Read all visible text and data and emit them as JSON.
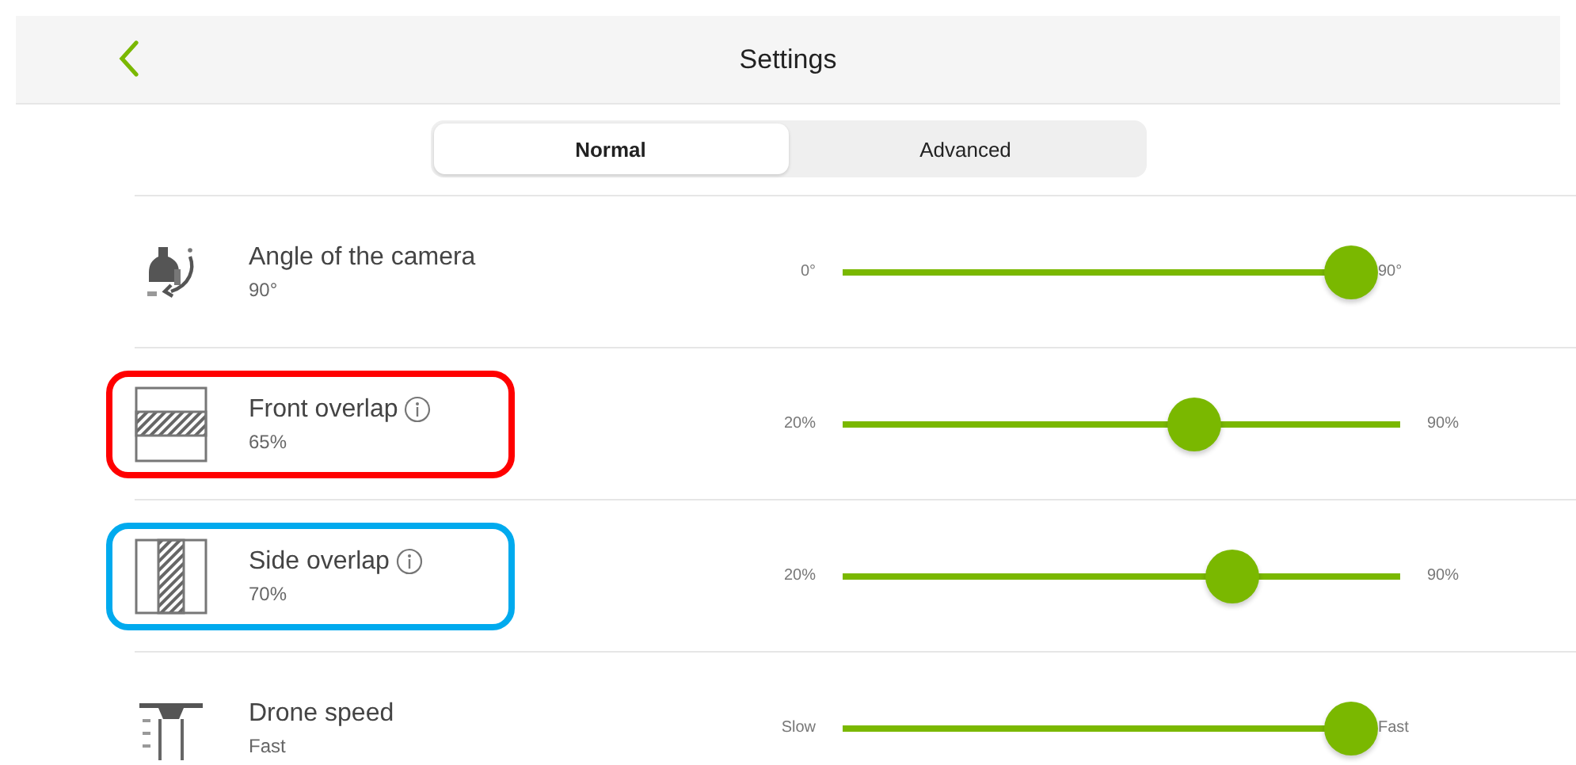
{
  "header": {
    "title": "Settings"
  },
  "tabs": [
    {
      "label": "Normal",
      "selected": true
    },
    {
      "label": "Advanced",
      "selected": false
    }
  ],
  "settings": [
    {
      "kind": "camera",
      "name": "Angle of the camera",
      "value": "90°",
      "info": false,
      "min_label": "0°",
      "max_label": "90°",
      "level": 1.0
    },
    {
      "kind": "front",
      "name": "Front overlap",
      "value": "65%",
      "info": true,
      "color": "#ff0000",
      "min_label": "20%",
      "max_label": "90%",
      "level": 0.63
    },
    {
      "kind": "side",
      "name": "Side overlap",
      "value": "70%",
      "info": true,
      "color": "#00aaee",
      "min_label": "20%",
      "max_label": "90%",
      "level": 0.7
    },
    {
      "kind": "drone",
      "name": "Drone speed",
      "value": "Fast",
      "info": false,
      "min_label": "Slow",
      "max_label": "Fast",
      "level": 1.0
    }
  ]
}
